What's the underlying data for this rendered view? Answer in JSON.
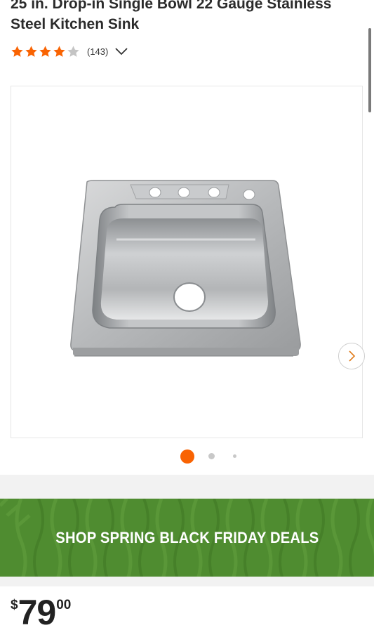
{
  "product": {
    "title": "25 in. Drop-in Single Bowl 22 Gauge Stainless Steel Kitchen Sink",
    "rating": 4,
    "rating_max": 5,
    "review_count": "(143)"
  },
  "gallery": {
    "image_alt": "stainless steel kitchen sink",
    "next_icon": "chevron-right-icon",
    "current_index": 1,
    "total_dots": 3
  },
  "promo": {
    "label": "SHOP SPRING BLACK FRIDAY DEALS",
    "background_color": "#4f8c30"
  },
  "price": {
    "currency": "$",
    "dollars": "79",
    "cents": "00"
  },
  "colors": {
    "star": "#f96302",
    "star_empty": "#c4c4c4",
    "active_dot": "#f96302",
    "inactive_dot": "#c8c8c8"
  }
}
